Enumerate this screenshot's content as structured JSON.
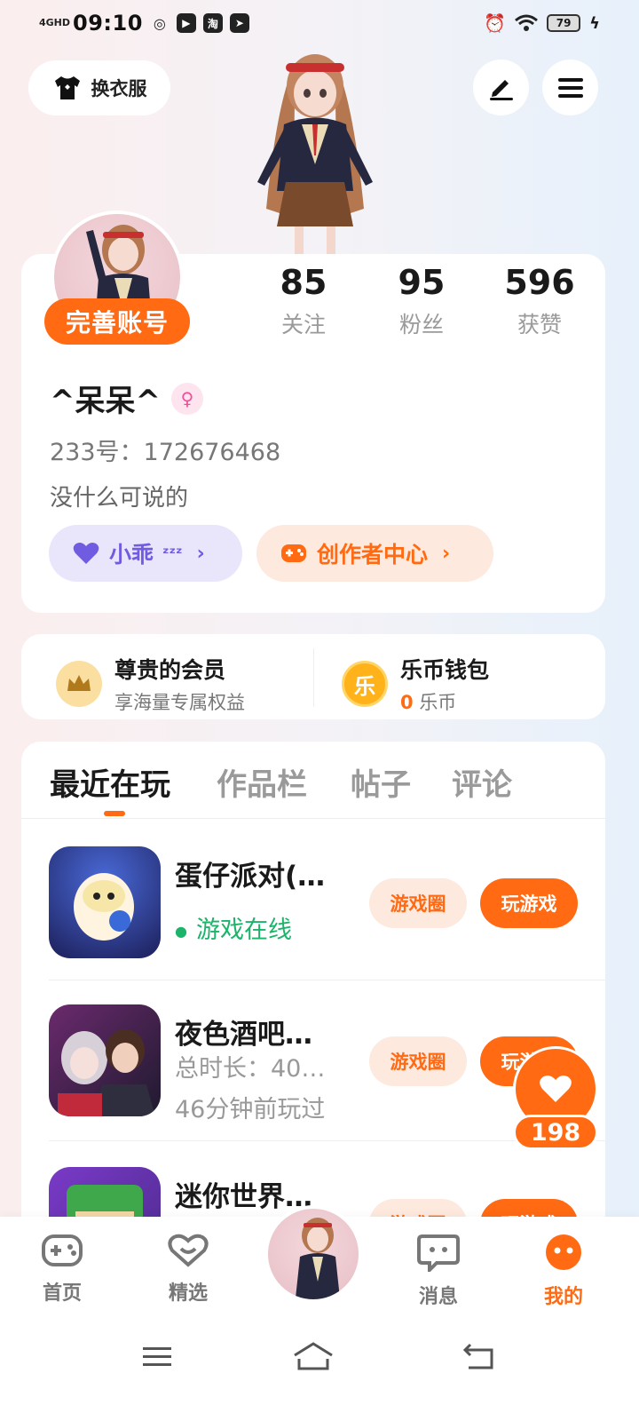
{
  "status_bar": {
    "network": "4GHD",
    "time": "09:10",
    "battery": "79"
  },
  "header": {
    "wardrobe_label": "换衣服"
  },
  "profile": {
    "complete_label": "完善账号",
    "stats": [
      {
        "value": "85",
        "label": "关注"
      },
      {
        "value": "95",
        "label": "粉丝"
      },
      {
        "value": "596",
        "label": "获赞"
      }
    ],
    "username": "^呆呆^",
    "uid": "233号：172676468",
    "bio": "没什么可说的",
    "mood_label": "小乖",
    "creator_label": "创作者中心"
  },
  "vip": {
    "title": "尊贵的会员",
    "subtitle": "享海量专属权益"
  },
  "wallet": {
    "title": "乐币钱包",
    "icon_text": "乐",
    "amount": "0",
    "unit": "乐币"
  },
  "tabs": [
    "最近在玩",
    "作品栏",
    "帖子",
    "评论"
  ],
  "games": [
    {
      "name": "蛋仔派对(…",
      "line1": "游戏在线",
      "line2": "",
      "circle_label": "游戏圈",
      "play_label": "玩游戏"
    },
    {
      "name": "夜色酒吧…",
      "line1": "总时长：40…",
      "line2": "46分钟前玩过",
      "circle_label": "游戏圈",
      "play_label": "玩游戏"
    },
    {
      "name": "迷你世界…",
      "line1": "",
      "line2": "",
      "circle_label": "游戏圈",
      "play_label": "玩游戏"
    }
  ],
  "like_count": "198",
  "nav": {
    "home": "首页",
    "featured": "精选",
    "messages": "消息",
    "mine": "我的"
  },
  "colors": {
    "accent": "#ff6a13",
    "online": "#1db36b",
    "mood": "#6f5ce0"
  }
}
